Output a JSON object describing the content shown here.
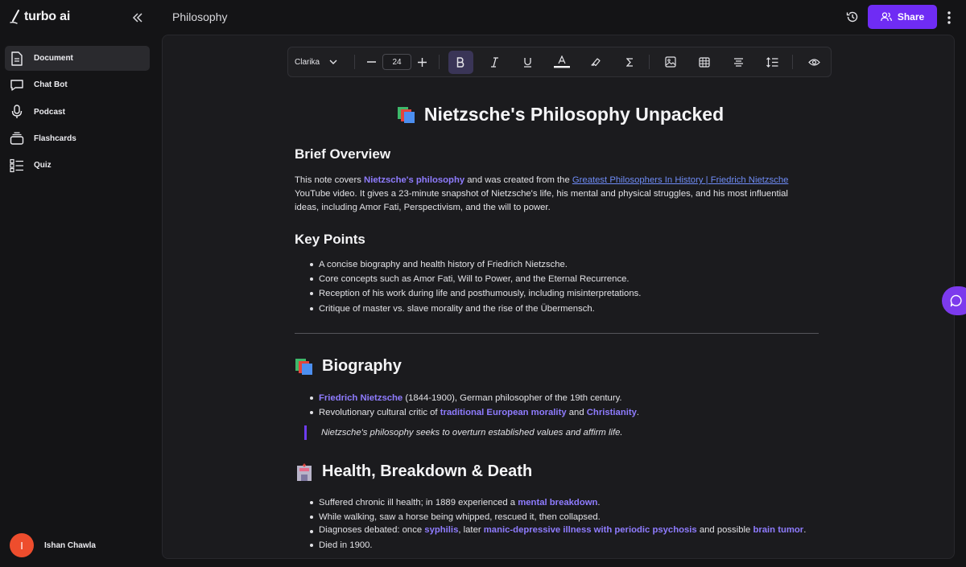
{
  "brand": {
    "name": "turbo ai"
  },
  "sidebar": {
    "items": [
      {
        "label": "Document",
        "icon": "document-icon",
        "active": true
      },
      {
        "label": "Chat Bot",
        "icon": "chat-bubble-icon"
      },
      {
        "label": "Podcast",
        "icon": "microphone-icon"
      },
      {
        "label": "Flashcards",
        "icon": "flashcards-icon"
      },
      {
        "label": "Quiz",
        "icon": "quiz-list-icon"
      }
    ],
    "user": {
      "initial": "I",
      "name": "Ishan Chawla"
    }
  },
  "header": {
    "title": "Philosophy",
    "share_label": "Share"
  },
  "toolbar": {
    "font": "Clarika",
    "font_size": "24",
    "icons": [
      "minus-icon",
      "plus-icon",
      "bold-icon",
      "italic-icon",
      "underline-icon",
      "text-color-icon",
      "highlighter-icon",
      "sigma-icon",
      "image-icon",
      "table-icon",
      "align-icon",
      "line-spacing-icon",
      "preview-eye-icon"
    ]
  },
  "doc": {
    "title": "Nietzsche's Philosophy Unpacked",
    "overview": {
      "heading": "Brief Overview",
      "p1": "This note covers ",
      "hl1": "Nietzsche's philosophy",
      "p2": " and was created from the ",
      "link": "Greatest Philosophers In History | Friedrich Nietzsche",
      "p3": "YouTube video. It gives a 23-minute snapshot of Nietzsche's life, his mental and physical struggles, and his most influential ideas, including Amor Fati, Perspectivism, and the will to power."
    },
    "key_points": {
      "heading": "Key Points",
      "items": [
        "A concise biography and health history of Friedrich Nietzsche.",
        "Core concepts such as Amor Fati, Will to Power, and the Eternal Recurrence.",
        "Reception of his work during life and posthumously, including misinterpretations.",
        "Critique of master vs. slave morality and the rise of the Übermensch."
      ]
    },
    "biography": {
      "heading": "Biography",
      "b1_hl": "Friedrich Nietzsche",
      "b1_rest": " (1844-1900), German philosopher of the 19th century.",
      "b2_pre": "Revolutionary cultural critic of ",
      "b2_hl1": "traditional European morality",
      "b2_mid": " and ",
      "b2_hl2": "Christianity",
      "b2_end": ".",
      "quote": "Nietzsche's philosophy seeks to overturn established values and affirm life."
    },
    "health": {
      "heading": "Health, Breakdown & Death",
      "h1_pre": "Suffered chronic ill health; in 1889 experienced a ",
      "h1_hl": "mental breakdown",
      "h1_end": ".",
      "h2": "While walking, saw a horse being whipped, rescued it, then collapsed.",
      "h3_pre": "Diagnoses debated: once ",
      "h3_hl1": "syphilis",
      "h3_mid": ", later ",
      "h3_hl2": "manic-depressive illness with periodic psychosis",
      "h3_mid2": " and possible ",
      "h3_hl3": "brain tumor",
      "h3_end": ".",
      "h4": "Died in 1900."
    }
  },
  "colors": {
    "accent": "#6f2cf4",
    "highlight": "#8f7cff",
    "link": "#6f8cf6",
    "avatar": "#ee4d2d"
  }
}
